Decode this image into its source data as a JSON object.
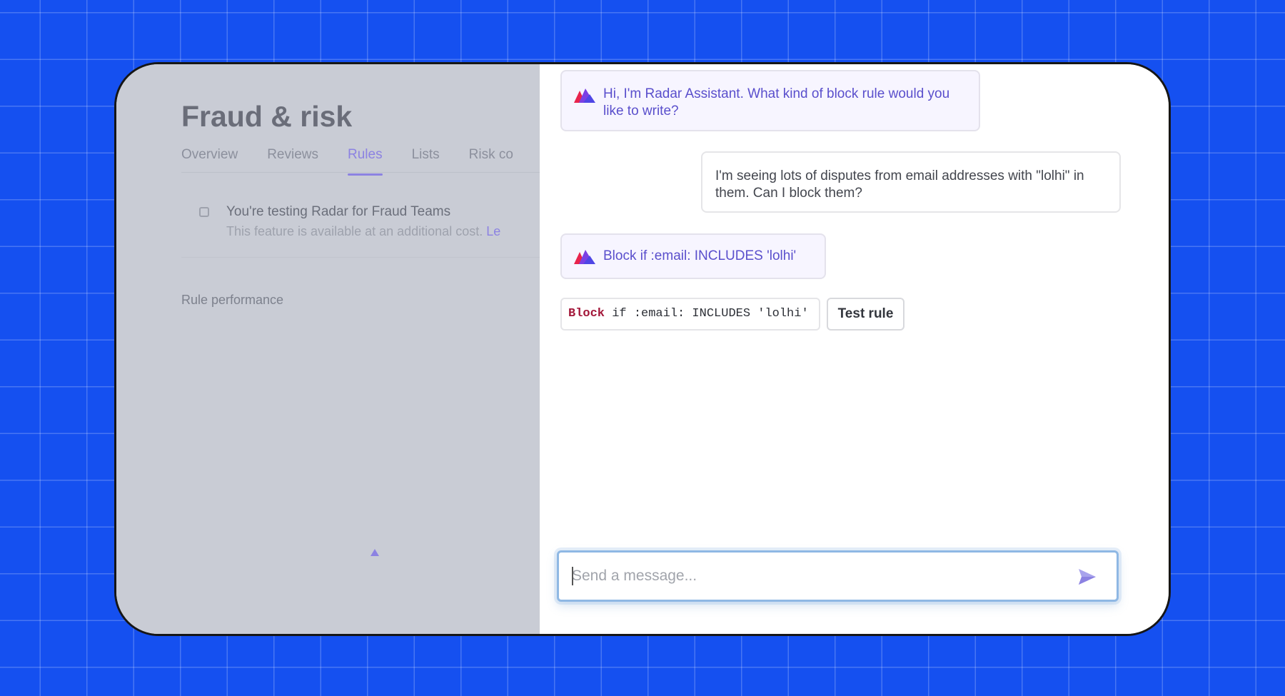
{
  "left_panel": {
    "title": "Fraud & risk",
    "tabs": [
      {
        "label": "Overview",
        "active": false
      },
      {
        "label": "Reviews",
        "active": false
      },
      {
        "label": "Rules",
        "active": true
      },
      {
        "label": "Lists",
        "active": false
      },
      {
        "label": "Risk co",
        "active": false
      }
    ],
    "notice": {
      "title": "You're testing Radar for Fraud Teams",
      "text": "This feature is available at an additional cost.",
      "link": "Le"
    },
    "section_label": "Rule performance"
  },
  "chat": {
    "messages": [
      {
        "role": "assistant",
        "text": "Hi, I'm Radar Assistant. What kind of block rule would you like to write?"
      },
      {
        "role": "user",
        "text": "I'm seeing lots of disputes from email addresses with \"lolhi\" in them. Can I block them?"
      },
      {
        "role": "assistant",
        "text": "Block if :email: INCLUDES 'lolhi'"
      }
    ],
    "rule_code": {
      "keyword": "Block",
      "rest": " if :email: INCLUDES 'lolhi'"
    },
    "test_rule_label": "Test rule",
    "input": {
      "placeholder": "Send a message...",
      "value": ""
    }
  },
  "icons": {
    "assistant_avatar": "radar-logo-icon",
    "send": "send-icon",
    "notice": "info-icon",
    "loading": "loading-triangle-icon"
  },
  "colors": {
    "background": "#1550f0",
    "assistant_text": "#5a4fcc",
    "accent": "#8c82e2",
    "code_keyword": "#a3183a",
    "input_focus": "#8fb8e4"
  }
}
